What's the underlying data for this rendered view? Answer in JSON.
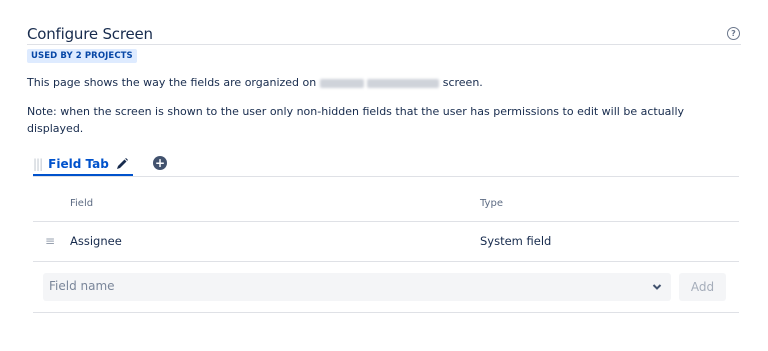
{
  "header": {
    "title": "Configure Screen",
    "badge": "USED BY 2 PROJECTS"
  },
  "description": {
    "prefix": "This page shows the way the fields are organized on",
    "suffix": "screen.",
    "note": "Note: when the screen is shown to the user only non-hidden fields that the user has permissions to edit will be actually displayed."
  },
  "tabs": [
    {
      "label": "Field Tab"
    }
  ],
  "table": {
    "columns": [
      "Field",
      "Type"
    ],
    "rows": [
      {
        "field": "Assignee",
        "type": "System field"
      }
    ]
  },
  "add_field": {
    "placeholder": "Field name",
    "button_label": "Add"
  },
  "icons": {
    "help": "help-circle-icon",
    "drag": "drag-handle-icon",
    "edit": "pencil-icon",
    "add_tab": "plus-circle-icon",
    "select": "chevron-down-icon"
  },
  "colors": {
    "accent": "#0052cc",
    "badge_bg": "#deebff",
    "badge_text": "#0747a6"
  }
}
